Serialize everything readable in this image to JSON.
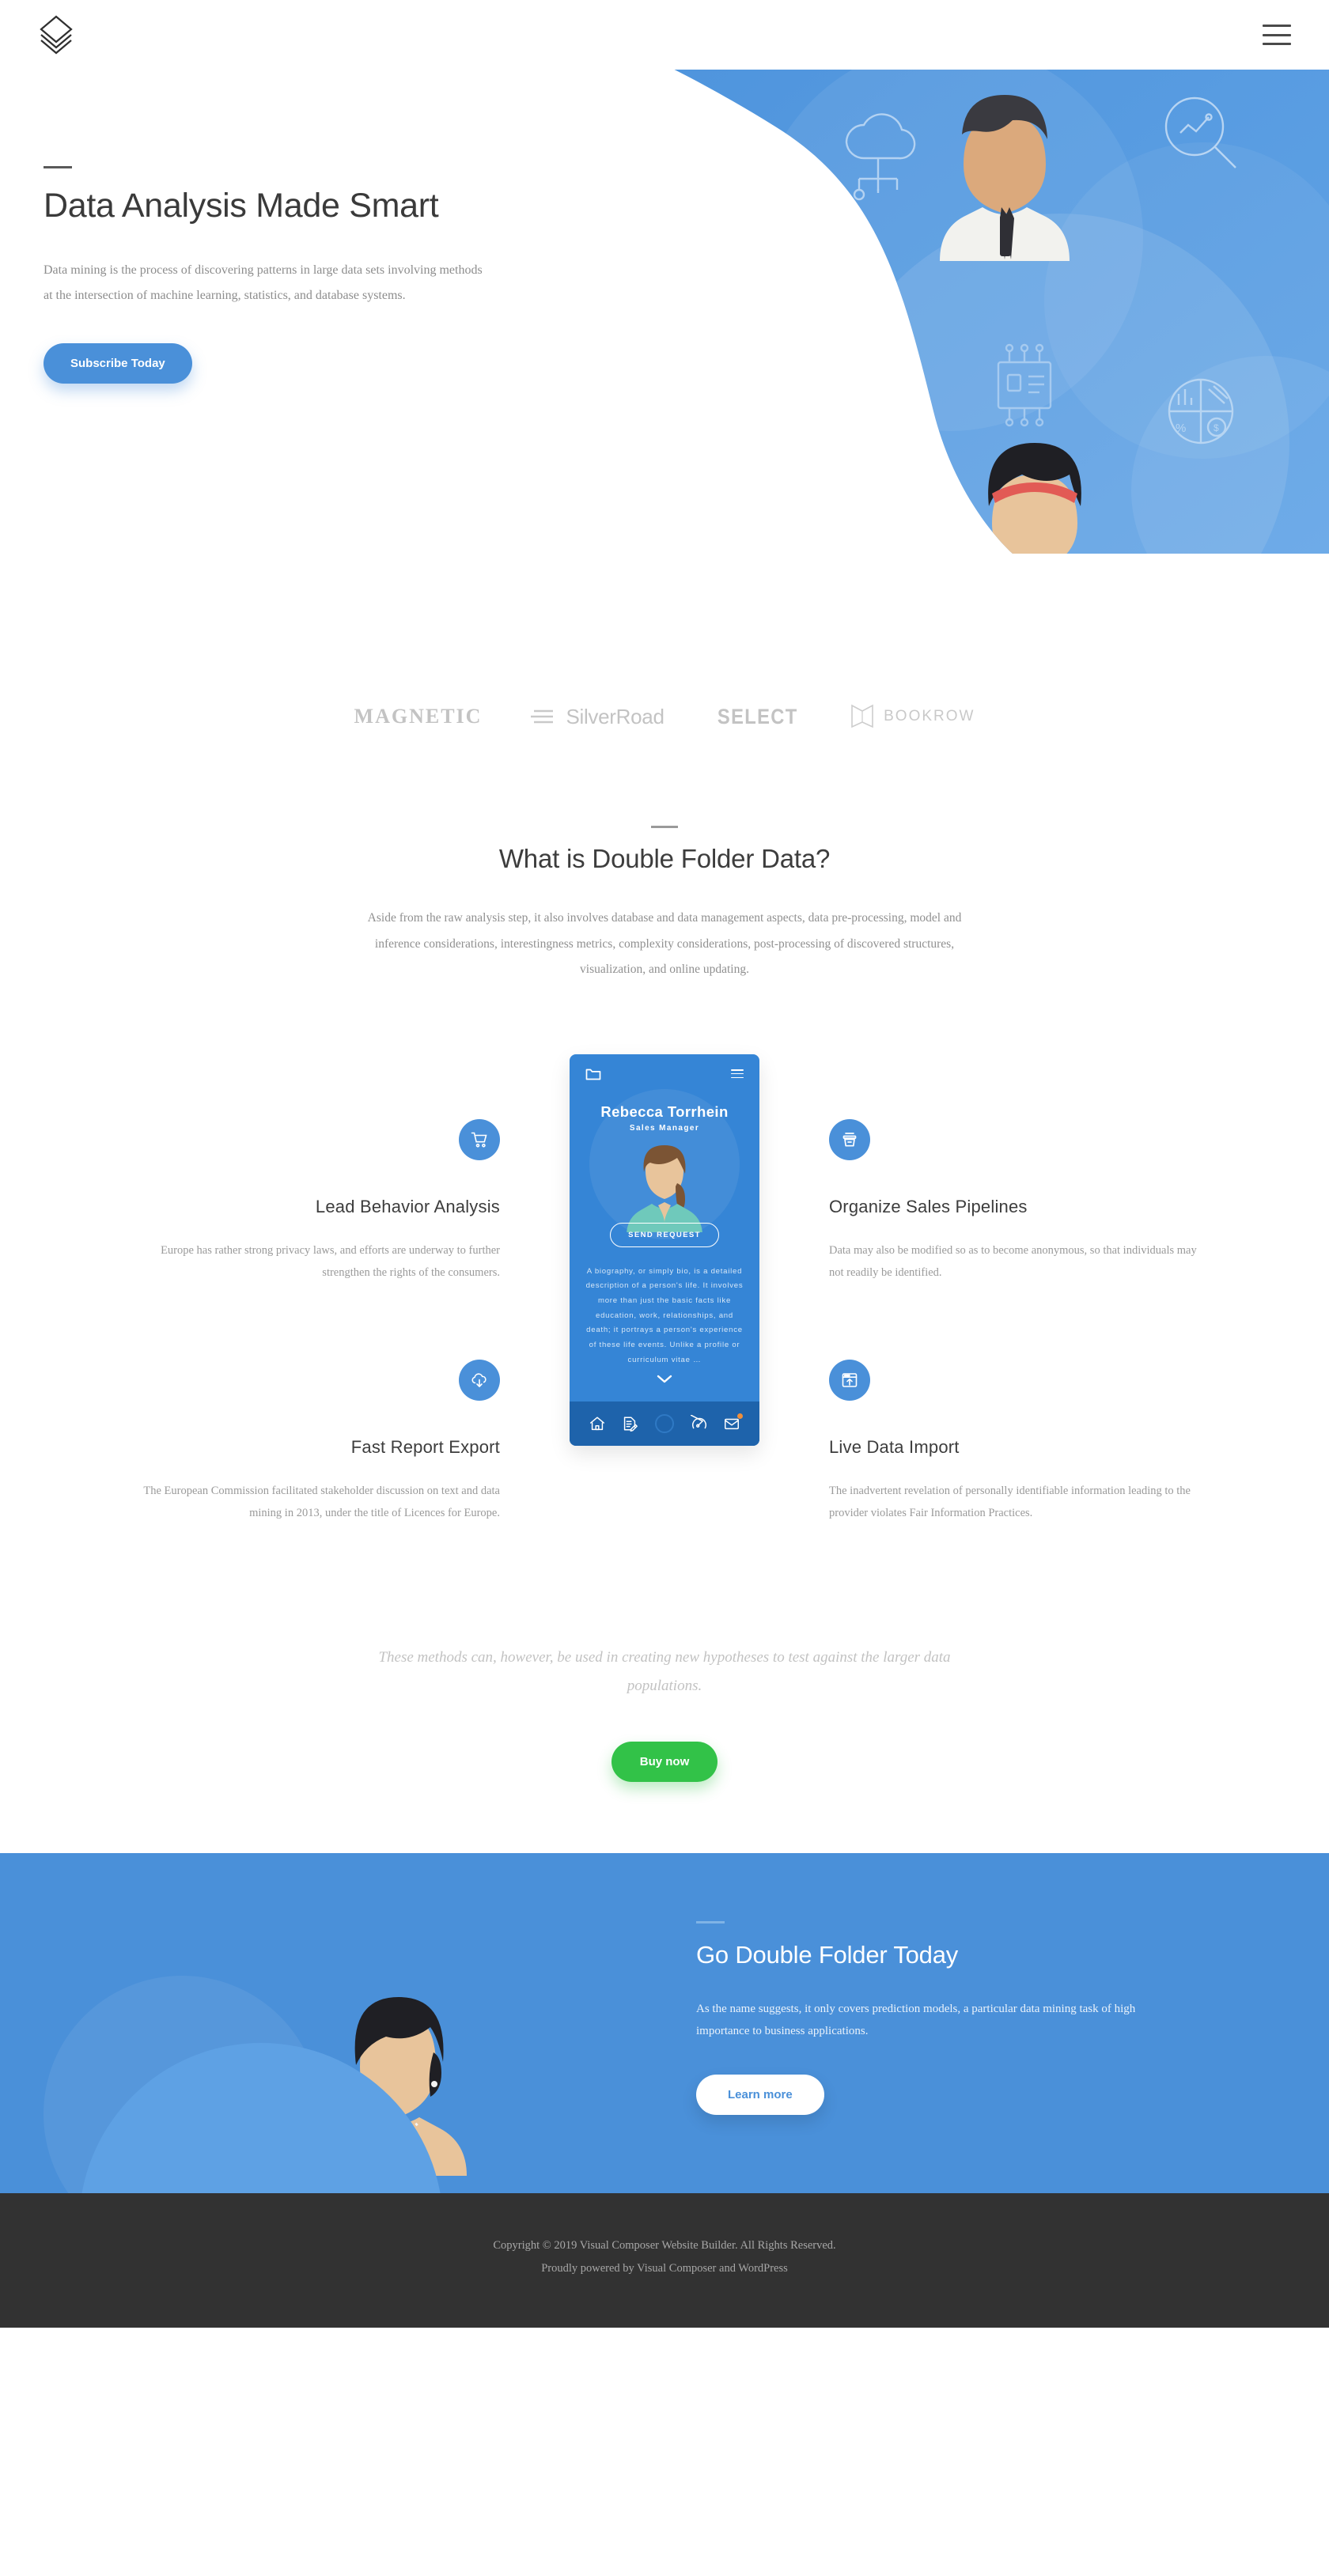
{
  "header": {
    "logo_name": "layers-logo",
    "menu_label": "Menu"
  },
  "hero": {
    "title": "Data Analysis Made Smart",
    "lead": "Data mining is the process of discovering patterns in large data sets involving methods at the intersection of machine learning, statistics, and database systems.",
    "cta_label": "Subscribe Today",
    "accent_color": "#4a90d9",
    "illustration_icons": [
      "cloud-network-icon",
      "magnifier-chart-icon",
      "id-chip-icon",
      "pie-chart-icon"
    ]
  },
  "brands": [
    {
      "name": "MAGNETIC",
      "icon": ""
    },
    {
      "name": "SilverRoad",
      "icon": "lines-icon"
    },
    {
      "name": "SELECT",
      "icon": ""
    },
    {
      "name": "BOOKROW",
      "icon": "book-icon"
    }
  ],
  "about": {
    "title": "What is Double Folder Data?",
    "lead": "Aside from the raw analysis step, it also involves database and data management aspects, data pre-processing, model and inference considerations, interestingness metrics, complexity considerations, post-processing of discovered structures, visualization, and online updating."
  },
  "features": {
    "left": [
      {
        "icon": "shopping-cart-icon",
        "title": "Lead Behavior Analysis",
        "desc": "Europe has rather strong privacy laws, and efforts are underway to further strengthen the rights of the consumers."
      },
      {
        "icon": "cloud-download-icon",
        "title": "Fast Report Export",
        "desc": "The European Commission facilitated stakeholder discussion on text and data mining in 2013, under the title of Licences for Europe."
      }
    ],
    "right": [
      {
        "icon": "archive-box-icon",
        "title": "Organize Sales Pipelines",
        "desc": "Data may also be modified so as to become anonymous, so that individuals may not readily be identified."
      },
      {
        "icon": "window-import-icon",
        "title": "Live Data Import",
        "desc": "The inadvertent revelation of personally identifiable information leading to the provider violates Fair Information Practices."
      }
    ]
  },
  "phone": {
    "app_icon": "folder-icon",
    "menu_icon": "hamburger-icon",
    "name": "Rebecca Torrhein",
    "role": "Sales Manager",
    "cta_label": "SEND REQUEST",
    "bio": "A biography, or simply bio, is a detailed description of a person's life. It involves more than just the basic facts like education, work, relationships, and death; it portrays a person's experience of these life events. Unlike a profile or curriculum vitae …",
    "expand_icon": "chevron-down-icon",
    "nav": [
      {
        "icon": "home-icon",
        "badge": false
      },
      {
        "icon": "document-edit-icon",
        "badge": false
      },
      {
        "icon": "circle-icon",
        "badge": false
      },
      {
        "icon": "speedometer-icon",
        "badge": false
      },
      {
        "icon": "mail-icon",
        "badge": true
      }
    ],
    "badge_color": "#ef8e3a"
  },
  "quote": {
    "text": "These methods can, however, be used in creating new hypotheses to test against the larger data populations.",
    "cta_label": "Buy now",
    "cta_color": "#32c248"
  },
  "cta": {
    "title": "Go Double Folder Today",
    "desc": "As the name suggests, it only covers prediction models, a particular data mining task of high importance to business applications.",
    "button_label": "Learn more",
    "background": "#4a90d9",
    "illustration_icons": [
      "sitemap-icon"
    ]
  },
  "footer": {
    "line1": "Copyright © 2019 Visual Composer Website Builder. All Rights Reserved.",
    "line2": "Proudly powered by Visual Composer and WordPress",
    "background": "#323232"
  }
}
